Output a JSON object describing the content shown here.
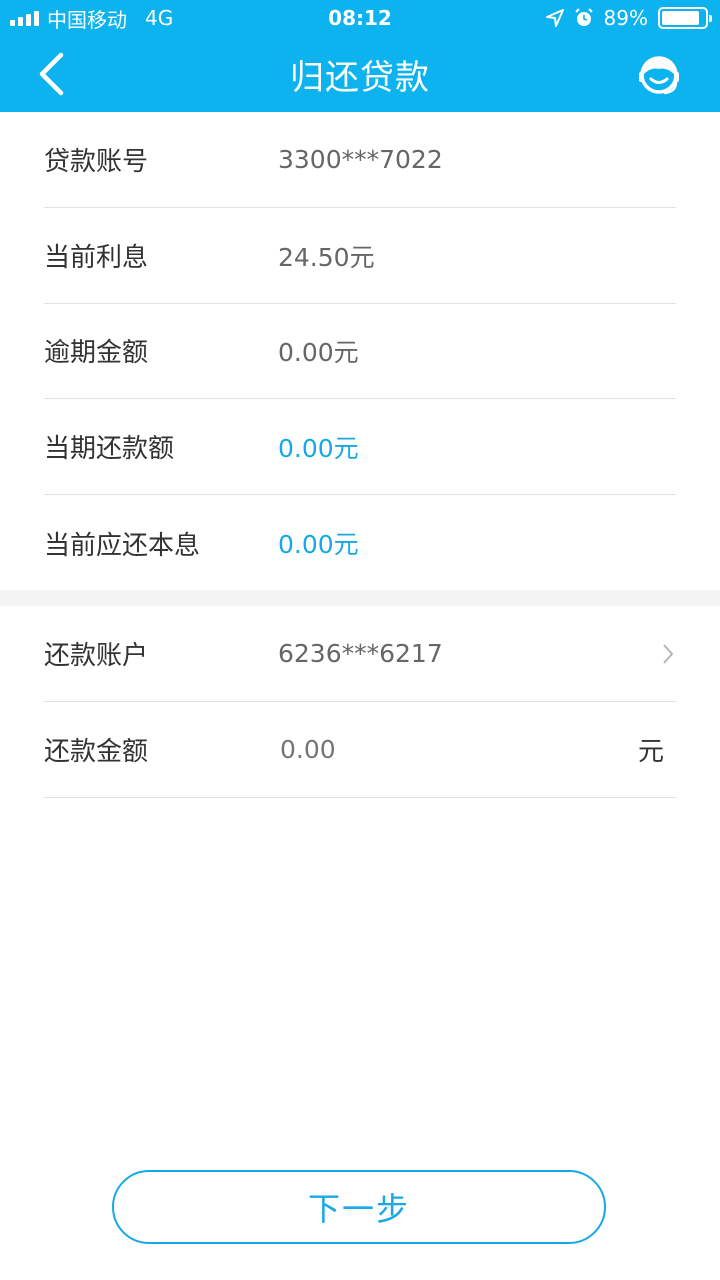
{
  "status_bar": {
    "carrier": "中国移动",
    "network": "4G",
    "time": "08:12",
    "battery_percent": "89%",
    "battery_level": 0.89,
    "icons": [
      "location-arrow-icon",
      "alarm-icon",
      "battery-icon",
      "signal-icon"
    ]
  },
  "nav": {
    "title": "归还贷款",
    "back_icon": "chevron-left-icon",
    "service_icon": "customer-service-icon"
  },
  "loan_info": {
    "rows": [
      {
        "label": "贷款账号",
        "value": "3300***7022"
      },
      {
        "label": "当前利息",
        "value": "24.50元"
      },
      {
        "label": "逾期金额",
        "value": "0.00元"
      },
      {
        "label": "当期还款额",
        "value": "0.00元"
      },
      {
        "label": "当前应还本息",
        "value": "0.00元"
      }
    ]
  },
  "repayment": {
    "account_label": "还款账户",
    "account_value": "6236***6217",
    "amount_label": "还款金额",
    "amount_placeholder": "0.00",
    "amount_unit": "元"
  },
  "actions": {
    "next_label": "下一步"
  },
  "colors": {
    "brand": "#0db3ef",
    "accent": "#17a8e6",
    "divider": "#e3e3e3"
  }
}
